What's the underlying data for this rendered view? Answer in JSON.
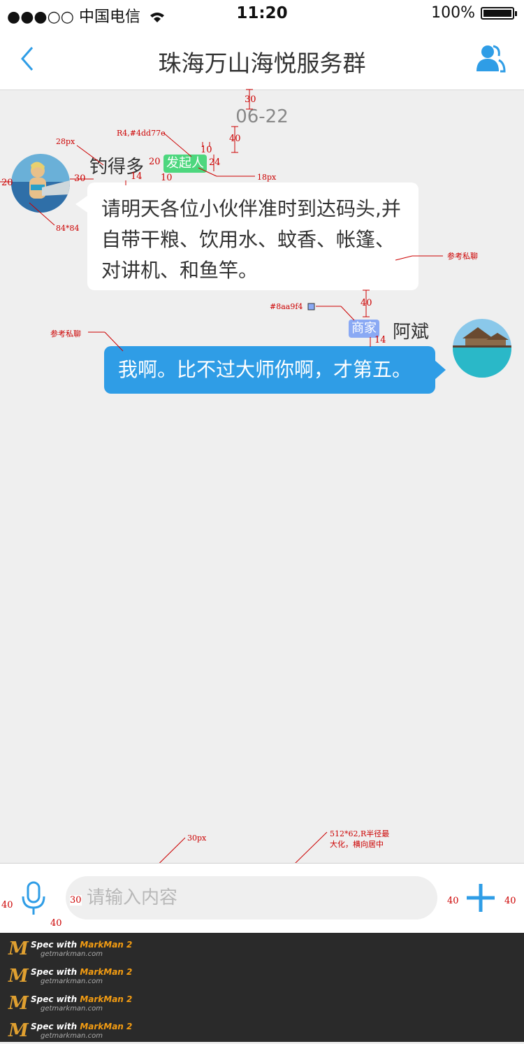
{
  "status_bar": {
    "carrier": "●●●○○ 中国电信",
    "time": "11:20",
    "battery": "100%"
  },
  "nav": {
    "title": "珠海万山海悦服务群",
    "back_icon": "chevron-left-icon",
    "group_icon": "group-members-icon"
  },
  "chat": {
    "date": "06-22",
    "messages": [
      {
        "side": "left",
        "sender": "钓得多",
        "tag": "发起人",
        "tag_color": "#4dd77e",
        "text": "请明天各位小伙伴准时到达码头,并自带干粮、饮用水、蚊香、帐篷、对讲机、和鱼竿。"
      },
      {
        "side": "right",
        "sender": "阿斌",
        "tag": "商家",
        "tag_color": "#8aa9f4",
        "text": "我啊。比不过大师你啊，才第五。"
      }
    ],
    "bubble_colors": {
      "left": "#ffffff",
      "right": "#2f9de6"
    }
  },
  "input": {
    "placeholder": "请输入内容",
    "mic_icon": "microphone-icon",
    "plus_icon": "plus-icon"
  },
  "annotations": {
    "t30_top": "30",
    "t40_date": "40",
    "tag_spec": "R4,#4dd77e",
    "t10a": "10",
    "t24": "24",
    "t28px": "28px",
    "t20a": "20",
    "t14a": "14",
    "t10b": "10",
    "t18px": "18px",
    "t20b": "20",
    "t30b": "30",
    "t84": "84*84",
    "ref1": "参考私聊",
    "t40_mid": "40",
    "merchant_color": "#8aa9f4",
    "ref2": "参考私聊",
    "t14b": "14",
    "t30px": "30px",
    "field_spec_1": "512*62,R半径最",
    "field_spec_2": "大化，横向居中",
    "t40_l": "40",
    "t30_field": "30",
    "t40_b": "40",
    "t40_r1": "40",
    "t40_r2": "40"
  },
  "watermark": {
    "line1_prefix": "Spec with ",
    "line1_brand": "MarkMan 2",
    "line2": "getmarkman.com",
    "logo": "M"
  }
}
